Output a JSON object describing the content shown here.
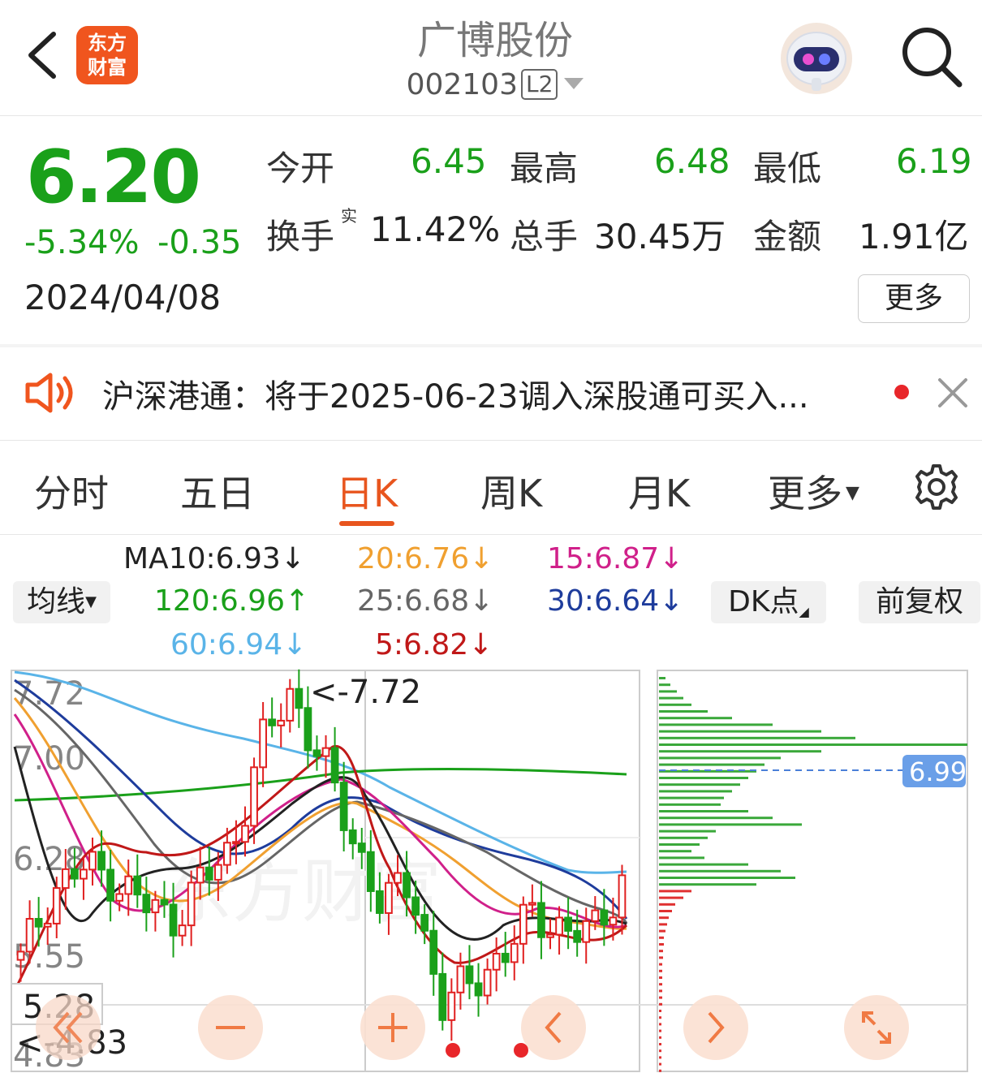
{
  "header": {
    "logo_line1": "东方",
    "logo_line2": "财富",
    "title": "广博股份",
    "code": "002103",
    "level": "L2"
  },
  "quote": {
    "price": "6.20",
    "change_pct": "-5.34%",
    "change": "-0.35",
    "date": "2024/04/08",
    "open_label": "今开",
    "open": "6.45",
    "high_label": "最高",
    "high": "6.48",
    "low_label": "最低",
    "low": "6.19",
    "turnover_label": "换手",
    "turnover_sup": "实",
    "turnover": "11.42%",
    "volume_label": "总手",
    "volume": "30.45万",
    "amount_label": "金额",
    "amount": "1.91亿",
    "more_label": "更多"
  },
  "notice": {
    "text": "沪深港通：将于2025-06-23调入深股通可买入..."
  },
  "tabs": [
    "分时",
    "五日",
    "日K",
    "周K",
    "月K",
    "更多"
  ],
  "ma": {
    "button": "均线",
    "ma10": "MA10:6.93↓",
    "ma20": "20:6.76↓",
    "ma15": "15:6.87↓",
    "ma120": "120:6.96↑",
    "ma25": "25:6.68↓",
    "ma30": "30:6.64↓",
    "ma60": "60:6.94↓",
    "ma5": "5:6.82↓",
    "dk_button": "DK点",
    "fq_button": "前复权"
  },
  "colors": {
    "up": "#e02020",
    "down": "#1aa01a",
    "accent": "#e8551e",
    "ma10": "#222222",
    "ma20": "#f0a030",
    "ma15": "#d0208a",
    "ma120": "#1aa01a",
    "ma25": "#666666",
    "ma30": "#1e3c9c",
    "ma60": "#5ab4e8",
    "ma5": "#c01818"
  },
  "chart_data": {
    "type": "candlestick",
    "y_ticks": [
      "7.72",
      "7.00",
      "6.28",
      "5.55",
      "4.83"
    ],
    "high_marker": "<-7.72",
    "low_marker": "<-4.83",
    "cursor_price": "5.28",
    "volume_profile_price": "6.99",
    "close": [
      5.62,
      6.1,
      6.3,
      6.22,
      6.05,
      5.9,
      6.2,
      6.4,
      7.2,
      7.55,
      7.1,
      6.5,
      6.05,
      6.15,
      5.3,
      5.45,
      5.65,
      5.95,
      5.85,
      5.8,
      6.2
    ]
  },
  "controls": {
    "zoom_out_icon": "minus-icon",
    "zoom_in_icon": "plus-icon",
    "prev_icon": "chevron-left-icon",
    "next_icon": "chevron-right-icon",
    "fullscreen_icon": "expand-icon",
    "rewind_icon": "double-chevron-left-icon"
  }
}
